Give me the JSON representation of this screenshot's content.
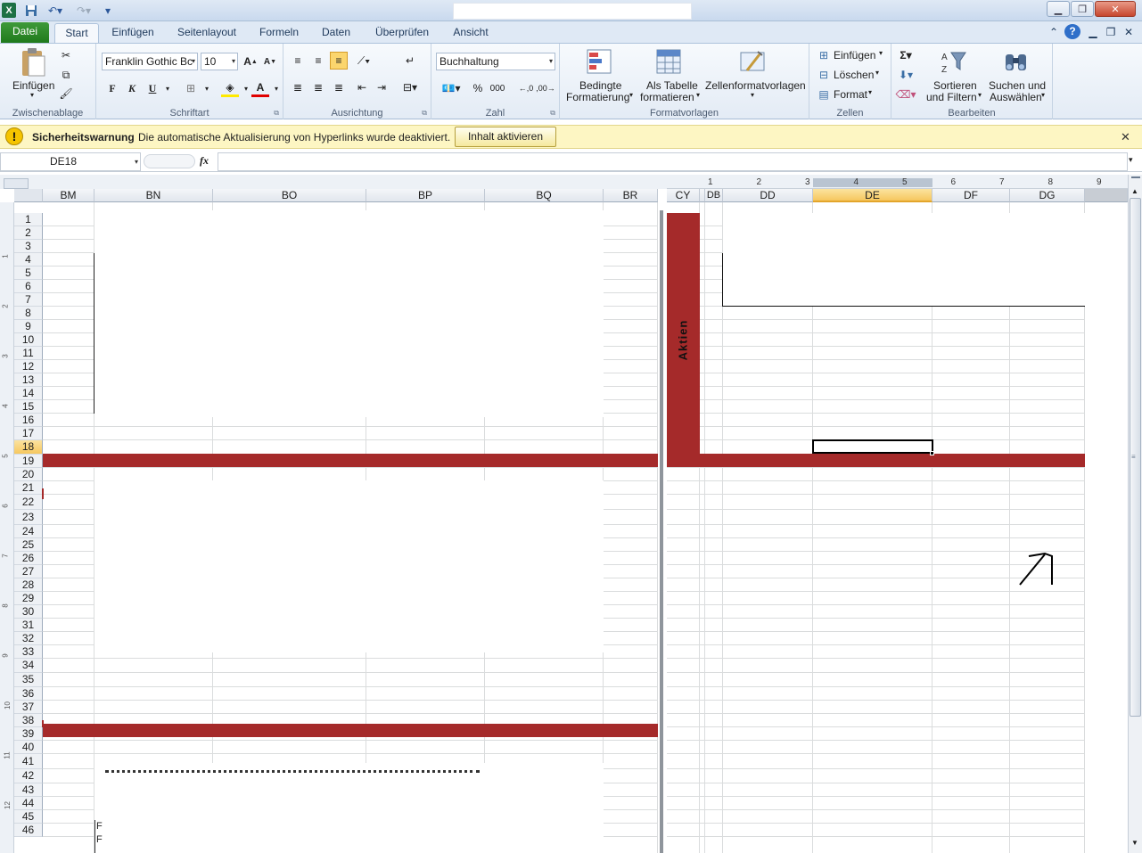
{
  "title_bar": {
    "title": "",
    "window_buttons": [
      "minimize",
      "maximize",
      "close"
    ]
  },
  "ribbon_tabs": {
    "file": "Datei",
    "start": "Start",
    "insert": "Einfügen",
    "page_layout": "Seitenlayout",
    "formulas": "Formeln",
    "data": "Daten",
    "review": "Überprüfen",
    "view": "Ansicht"
  },
  "clipboard": {
    "paste": "Einfügen",
    "label": "Zwischenablage"
  },
  "font": {
    "name": "Franklin Gothic Bc",
    "size": "10",
    "bold": "F",
    "italic": "K",
    "underline": "U",
    "label": "Schriftart"
  },
  "alignment": {
    "label": "Ausrichtung"
  },
  "number": {
    "format": "Buchhaltung",
    "label": "Zahl"
  },
  "styles": {
    "conditional_l1": "Bedingte",
    "conditional_l2": "Formatierung",
    "table_l1": "Als Tabelle",
    "table_l2": "formatieren",
    "cellstyles": "Zellenformatvorlagen",
    "label": "Formatvorlagen"
  },
  "cells": {
    "insert": "Einfügen",
    "delete": "Löschen",
    "format": "Format",
    "label": "Zellen"
  },
  "editing": {
    "sort_l1": "Sortieren",
    "sort_l2": "und Filtern",
    "find_l1": "Suchen und",
    "find_l2": "Auswählen",
    "label": "Bearbeiten"
  },
  "security_bar": {
    "title": "Sicherheitswarnung",
    "message": "Die automatische Aktualisierung von Hyperlinks wurde deaktiviert.",
    "button": "Inhalt aktivieren"
  },
  "formula_bar": {
    "name_box": "DE18",
    "fx": "fx",
    "formula": ""
  },
  "left_pane": {
    "columns": [
      "BM",
      "BN",
      "BO",
      "BP",
      "BQ",
      "BR"
    ],
    "rows": [
      "1",
      "2",
      "3",
      "4",
      "5",
      "6",
      "7",
      "8",
      "9",
      "10",
      "11",
      "12",
      "13",
      "14",
      "15",
      "16",
      "17",
      "18",
      "19",
      "20",
      "21",
      "22",
      "23",
      "24",
      "25",
      "26",
      "27",
      "28",
      "29",
      "30",
      "31",
      "32",
      "33",
      "34",
      "35",
      "36",
      "37",
      "38",
      "39",
      "40",
      "41",
      "42",
      "43",
      "44",
      "45",
      "46"
    ]
  },
  "right_pane": {
    "columns": [
      "CY",
      "DB",
      "DD",
      "DE",
      "DF",
      "DG"
    ],
    "selected_column": "DE",
    "ruler_marks": [
      "1",
      "2",
      "3",
      "4",
      "5",
      "6",
      "7",
      "8",
      "9"
    ],
    "aktien_label": "Aktien",
    "cell_letters": [
      "F",
      "F"
    ]
  },
  "selected_row": "18",
  "colors": {
    "accent": "#a52a2a",
    "file_tab": "#2a8a26",
    "selection": "#f6c75f"
  }
}
